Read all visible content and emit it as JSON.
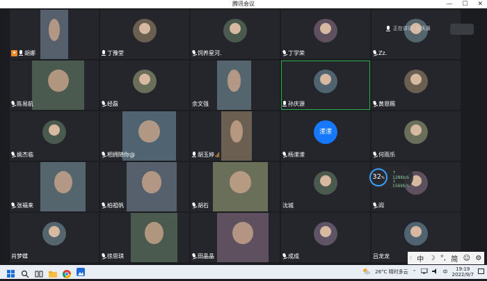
{
  "window": {
    "title": "腾讯会议"
  },
  "speaking": {
    "label": "正在讲话: 孙庆源"
  },
  "participants": [
    {
      "name": "胡娜",
      "type": "video",
      "host": true,
      "mic": "on"
    },
    {
      "name": "丁豫堂",
      "type": "avatar",
      "mic": "on"
    },
    {
      "name": "饲养星河.",
      "type": "avatar",
      "mic": "off"
    },
    {
      "name": "丁学荣",
      "type": "avatar",
      "mic": "off"
    },
    {
      "name": "Zz.",
      "type": "avatar",
      "mic": "off"
    },
    {
      "name": "陈易航",
      "type": "video",
      "mic": "off"
    },
    {
      "name": "经磊",
      "type": "avatar",
      "mic": "off"
    },
    {
      "name": "余文强",
      "type": "video",
      "mic": "none"
    },
    {
      "name": "孙庆源",
      "type": "avatar",
      "mic": "on",
      "active": true
    },
    {
      "name": "黄恩赐",
      "type": "avatar",
      "mic": "off"
    },
    {
      "name": "姚杰临",
      "type": "avatar",
      "mic": "off"
    },
    {
      "name": "相拥随你@",
      "type": "video",
      "mic": "off"
    },
    {
      "name": "胡玉婷",
      "type": "video",
      "mic": "on",
      "bars": true
    },
    {
      "name": "杨潆潆",
      "type": "text",
      "initials": "潆潆",
      "mic": "off"
    },
    {
      "name": "何雨乐",
      "type": "avatar",
      "mic": "off"
    },
    {
      "name": "张福来",
      "type": "video",
      "mic": "off"
    },
    {
      "name": "柏祖帆",
      "type": "video",
      "mic": "off"
    },
    {
      "name": "胡石",
      "type": "video",
      "mic": "off"
    },
    {
      "name": "沈城",
      "type": "avatar",
      "mic": "none"
    },
    {
      "name": "阎",
      "type": "avatar",
      "mic": "off"
    },
    {
      "name": "肖梦蝶",
      "type": "avatar",
      "mic": "none"
    },
    {
      "name": "徐思琪",
      "type": "video",
      "mic": "off"
    },
    {
      "name": "田晶晶",
      "type": "video",
      "mic": "off"
    },
    {
      "name": "成成",
      "type": "avatar",
      "mic": "off"
    },
    {
      "name": "吕龙龙",
      "type": "avatar",
      "mic": "none"
    }
  ],
  "net_stats": {
    "quality": "32",
    "unit": "%",
    "up": "128kb/s",
    "down": "156kb/s"
  },
  "ime": {
    "lang": "中",
    "mode1": "☽",
    "punct": "°,",
    "charset": "简",
    "emoji": "☺",
    "settings": "⚙"
  },
  "taskbar": {
    "weather_temp": "26°C",
    "weather_desc": "晴时多云",
    "ime_lang": "中",
    "time": "19:19",
    "date": "2022/9/7"
  }
}
